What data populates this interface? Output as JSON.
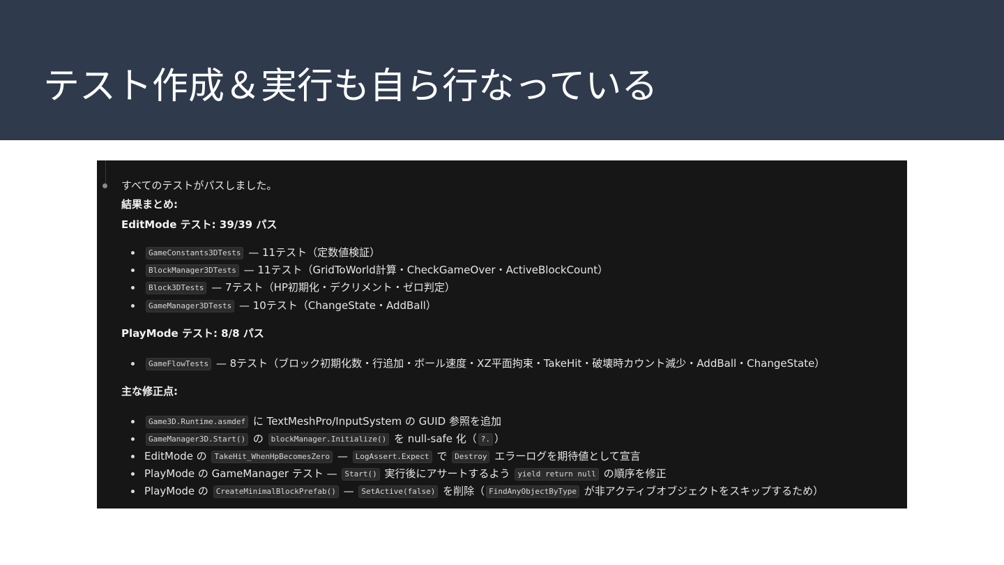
{
  "slide": {
    "title": "テスト作成＆実行も自ら行なっている"
  },
  "terminal": {
    "status": "すべてのテストがパスしました。",
    "summary_heading": "結果まとめ:",
    "editmode_heading": "EditMode テスト: 39/39 パス",
    "editmode_items": [
      {
        "code": "GameConstants3DTests",
        "text": " — 11テスト（定数値検証）"
      },
      {
        "code": "BlockManager3DTests",
        "text": " — 11テスト（GridToWorld計算・CheckGameOver・ActiveBlockCount）"
      },
      {
        "code": "Block3DTests",
        "text": " — 7テスト（HP初期化・デクリメント・ゼロ判定）"
      },
      {
        "code": "GameManager3DTests",
        "text": " — 10テスト（ChangeState・AddBall）"
      }
    ],
    "playmode_heading": "PlayMode テスト: 8/8 パス",
    "playmode_items": [
      {
        "code": "GameFlowTests",
        "text": " — 8テスト（ブロック初期化数・行追加・ボール速度・XZ平面拘束・TakeHit・破壊時カウント減少・AddBall・ChangeState）"
      }
    ],
    "fixes_heading": "主な修正点:",
    "fixes": [
      {
        "c1": "Game3D.Runtime.asmdef",
        "t1": " に TextMeshPro/InputSystem の GUID 参照を追加"
      },
      {
        "c1": "GameManager3D.Start()",
        "t1": " の ",
        "c2": "blockManager.Initialize()",
        "t2": " を null-safe 化（",
        "c3": "?.",
        "t3": "）"
      },
      {
        "t0": "EditMode の ",
        "c1": "TakeHit_WhenHpBecomesZero",
        "t1": " — ",
        "c2": "LogAssert.Expect",
        "t2": " で ",
        "c3": "Destroy",
        "t3": " エラーログを期待値として宣言"
      },
      {
        "t0": "PlayMode の GameManager テスト — ",
        "c1": "Start()",
        "t1": " 実行後にアサートするよう ",
        "c2": "yield return null",
        "t2": " の順序を修正"
      },
      {
        "t0": "PlayMode の ",
        "c1": "CreateMinimalBlockPrefab()",
        "t1": " — ",
        "c2": "SetActive(false)",
        "t2": " を削除（",
        "c3": "FindAnyObjectByType",
        "t3": " が非アクティブオブジェクトをスキップするため）"
      }
    ]
  },
  "colors": {
    "header_bg": "#2f3a4d",
    "terminal_bg": "#161616",
    "code_bg": "#2c2c2c",
    "text": "#e6e6e6"
  }
}
